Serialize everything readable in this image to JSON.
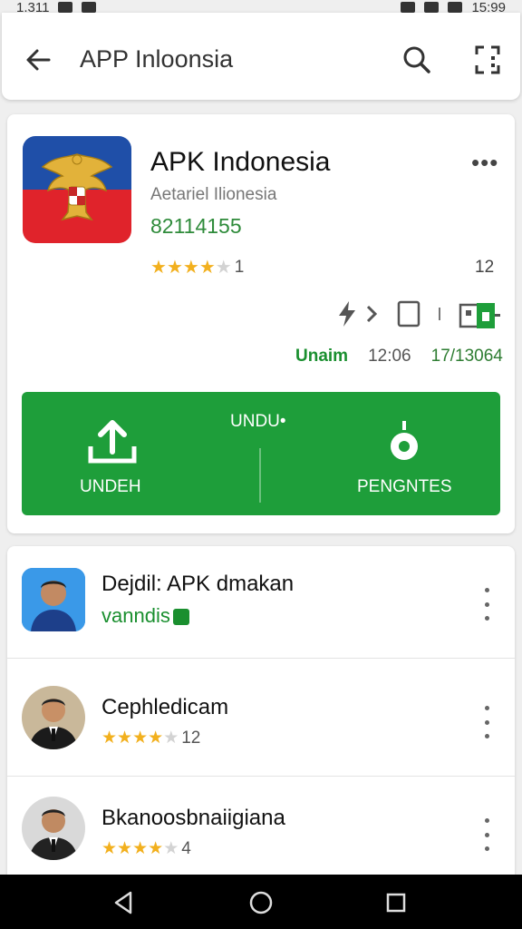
{
  "status_bar": {
    "left": "1.311",
    "time": "15:99"
  },
  "header": {
    "title": "APP Inloonsia"
  },
  "app": {
    "name": "APK Indonesia",
    "developer": "Aetariel Ilionesia",
    "code": "82114155",
    "rating": 4.5,
    "rating_count": "1",
    "review_count": "12",
    "meta": {
      "label": "Unaim",
      "time": "12:06",
      "date": "17/13064"
    }
  },
  "actions": {
    "upload_label": "UNDEH",
    "center_label": "UNDU•",
    "settings_label": "PENGNTES"
  },
  "list": [
    {
      "title": "Dejdil: APK dmakan",
      "subtitle": "vanndis"
    },
    {
      "title": "Cephledicam",
      "rating": 4.5,
      "count": "12"
    },
    {
      "title": "Bkanoosbnaiigiana",
      "rating": 4,
      "count": "4"
    }
  ],
  "colors": {
    "green": "#1e9e3a",
    "star": "#f2b01e"
  }
}
